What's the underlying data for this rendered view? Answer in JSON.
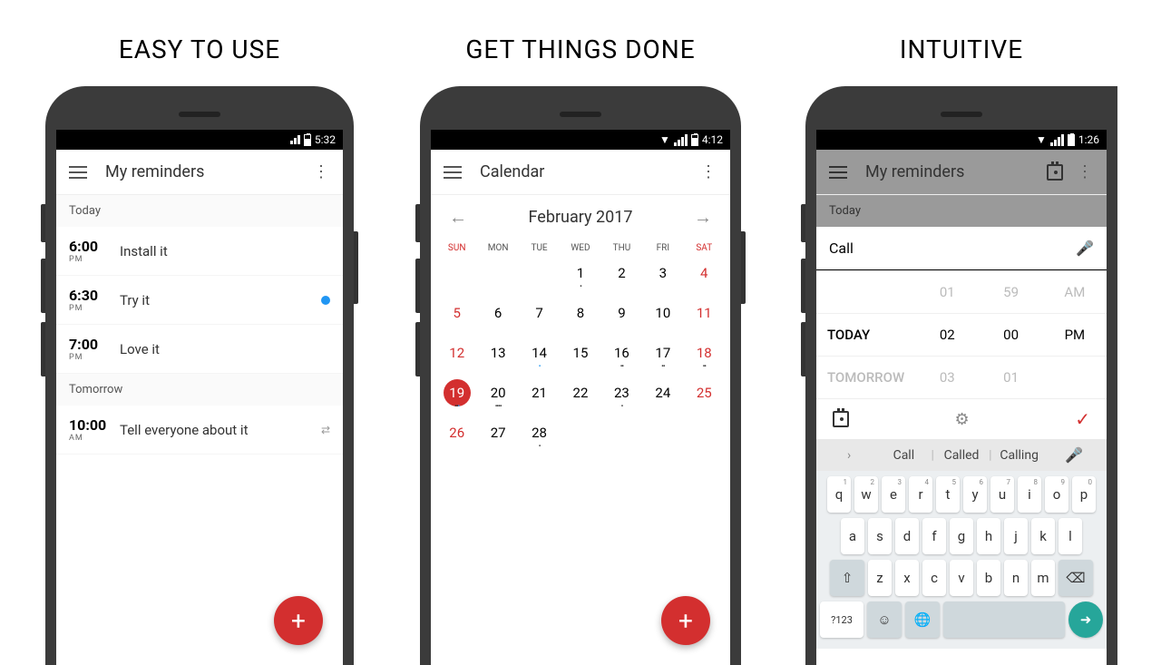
{
  "taglines": [
    "EASY TO USE",
    "GET THINGS DONE",
    "INTUITIVE"
  ],
  "phone1": {
    "status_time": "5:32",
    "title": "My reminders",
    "sections": [
      {
        "label": "Today",
        "items": [
          {
            "time": "6:00",
            "ampm": "PM",
            "text": "Install it",
            "dot": false
          },
          {
            "time": "6:30",
            "ampm": "PM",
            "text": "Try it",
            "dot": true
          },
          {
            "time": "7:00",
            "ampm": "PM",
            "text": "Love it",
            "dot": false
          }
        ]
      },
      {
        "label": "Tomorrow",
        "items": [
          {
            "time": "10:00",
            "ampm": "AM",
            "text": "Tell everyone about it",
            "repeat": true
          }
        ]
      }
    ]
  },
  "phone2": {
    "status_time": "4:12",
    "title": "Calendar",
    "month": "February 2017",
    "weekdays": [
      "SUN",
      "MON",
      "TUE",
      "WED",
      "THU",
      "FRI",
      "SAT"
    ],
    "todayDate": "19",
    "rows": [
      [
        "",
        "",
        "",
        "1",
        "2",
        "3",
        "4"
      ],
      [
        "5",
        "6",
        "7",
        "8",
        "9",
        "10",
        "11"
      ],
      [
        "12",
        "13",
        "14",
        "15",
        "16",
        "17",
        "18"
      ],
      [
        "19",
        "20",
        "21",
        "22",
        "23",
        "24",
        "25"
      ],
      [
        "26",
        "27",
        "28",
        "",
        "",
        "",
        ""
      ]
    ]
  },
  "phone3": {
    "status_time": "1:26",
    "title": "My reminders",
    "section": "Today",
    "input": "Call",
    "picker": {
      "rows": [
        [
          "",
          "01",
          "59",
          "AM"
        ],
        [
          "TODAY",
          "02",
          "00",
          "PM"
        ],
        [
          "TOMORROW",
          "03",
          "01",
          ""
        ]
      ]
    },
    "suggestions": [
      "Call",
      "Called",
      "Calling"
    ],
    "kb": {
      "r1": [
        [
          "q",
          "1"
        ],
        [
          "w",
          "2"
        ],
        [
          "e",
          "3"
        ],
        [
          "r",
          "4"
        ],
        [
          "t",
          "5"
        ],
        [
          "y",
          "6"
        ],
        [
          "u",
          "7"
        ],
        [
          "i",
          "8"
        ],
        [
          "o",
          "9"
        ],
        [
          "p",
          "0"
        ]
      ],
      "r2": [
        "a",
        "s",
        "d",
        "f",
        "g",
        "h",
        "j",
        "k",
        "l"
      ],
      "r3": [
        "z",
        "x",
        "c",
        "v",
        "b",
        "n",
        "m"
      ],
      "bottom_left": "?123"
    }
  }
}
